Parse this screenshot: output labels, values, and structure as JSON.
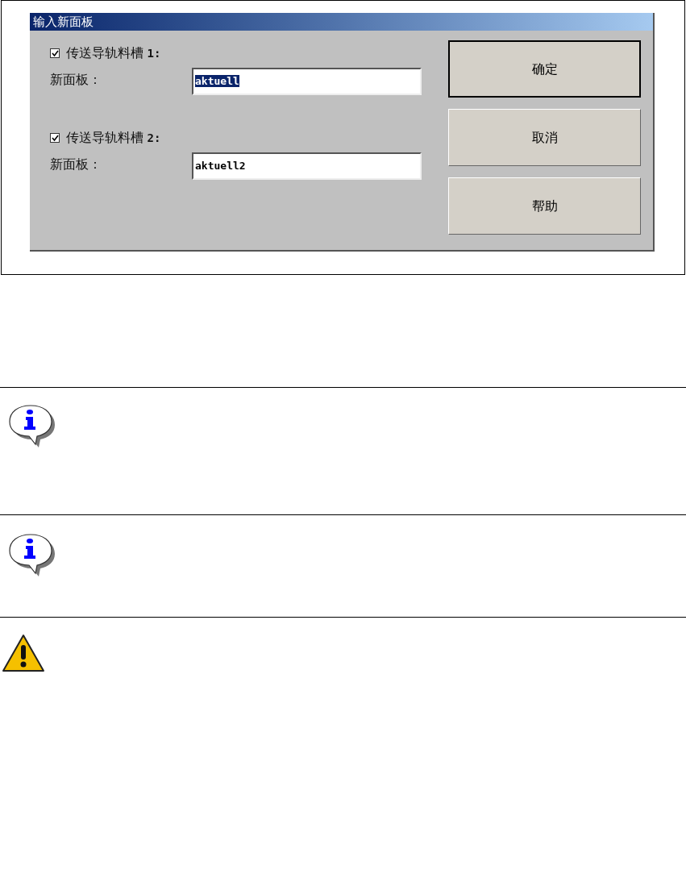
{
  "dialog": {
    "title": "输入新面板",
    "slots": [
      {
        "label": "传送导轨料槽 **1:**",
        "checked": true,
        "field_label": "新面板：",
        "value": "aktuell",
        "selected": true
      },
      {
        "label": "传送导轨料槽 **2:**",
        "checked": true,
        "field_label": "新面板：",
        "value": "aktuell2",
        "selected": false
      }
    ],
    "buttons": [
      {
        "label": "确定",
        "default": true
      },
      {
        "label": "取消",
        "default": false
      },
      {
        "label": "帮助",
        "default": false
      }
    ]
  },
  "notes": [
    {
      "kind": "info"
    },
    {
      "kind": "info"
    },
    {
      "kind": "warning"
    }
  ]
}
